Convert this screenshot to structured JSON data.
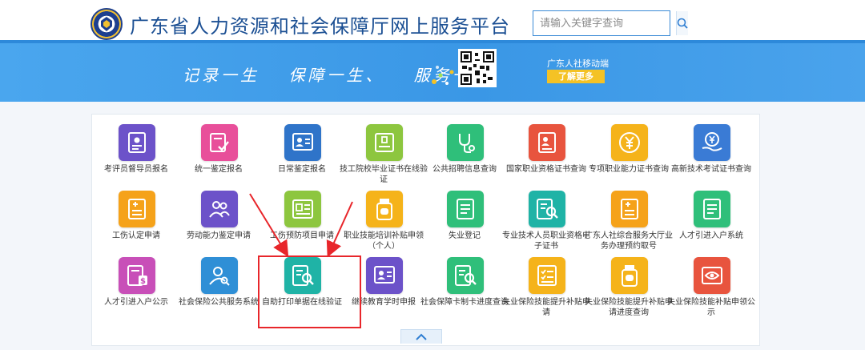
{
  "header": {
    "title": "广东省人力资源和社会保障厅网上服务平台",
    "search_placeholder": "请输入关键字查询",
    "logo_icon": "emblem-icon",
    "search_icon": "search-icon"
  },
  "banner": {
    "slogan": [
      "记录一生",
      "保障一生、",
      "服务一生"
    ],
    "mobile_label": "广东人社移动端",
    "more_button": "了解更多"
  },
  "services": [
    {
      "label": "考评员督导员报名",
      "icon": "id-card-icon",
      "color": "#6c52c9"
    },
    {
      "label": "统一鉴定报名",
      "icon": "document-check-icon",
      "color": "#e84f9a"
    },
    {
      "label": "日常鉴定报名",
      "icon": "profile-card-icon",
      "color": "#2f74c9"
    },
    {
      "label": "技工院校毕业证书在线验证",
      "icon": "certificate-icon",
      "color": "#8dc63f"
    },
    {
      "label": "公共招聘信息查询",
      "icon": "stethoscope-icon",
      "color": "#2fbf7a"
    },
    {
      "label": "国家职业资格证书查询",
      "icon": "person-document-icon",
      "color": "#e8543e"
    },
    {
      "label": "专项职业能力证书查询",
      "icon": "yen-coin-icon",
      "color": "#f5b31a"
    },
    {
      "label": "高新技术考试证书查询",
      "icon": "yen-hand-icon",
      "color": "#3a7bd5"
    },
    {
      "label": "工伤认定申请",
      "icon": "form-plus-icon",
      "color": "#f5a21a"
    },
    {
      "label": "劳动能力鉴定申请",
      "icon": "people-icon",
      "color": "#6c52c9"
    },
    {
      "label": "工伤预防项目申请",
      "icon": "list-card-icon",
      "color": "#8dc63f"
    },
    {
      "label": "职业技能培训补贴申领（个人）",
      "icon": "medicine-bottle-icon",
      "color": "#f5b31a"
    },
    {
      "label": "失业登记",
      "icon": "form-lines-icon",
      "color": "#2fbf7a"
    },
    {
      "label": "专业技术人员职业资格电子证书",
      "icon": "search-document-icon",
      "color": "#1fb3a6"
    },
    {
      "label": "广东人社综合服务大厅业务办理预约取号",
      "icon": "form-plus-icon",
      "color": "#f5a21a"
    },
    {
      "label": "人才引进入户系统",
      "icon": "form-lines-icon",
      "color": "#2fbf7a"
    },
    {
      "label": "人才引进入户公示",
      "icon": "dollar-document-icon",
      "color": "#c84fb8"
    },
    {
      "label": "社会保险公共服务系统",
      "icon": "user-search-icon",
      "color": "#2f8fd6"
    },
    {
      "label": "自助打印单据在线验证",
      "icon": "search-document-icon",
      "color": "#1fb3a6"
    },
    {
      "label": "继续教育学时申报",
      "icon": "profile-card-icon",
      "color": "#6c52c9"
    },
    {
      "label": "社会保障卡制卡进度查询",
      "icon": "search-document-icon",
      "color": "#2fbf7a"
    },
    {
      "label": "失业保险技能提升补贴申请",
      "icon": "checklist-icon",
      "color": "#f5b31a"
    },
    {
      "label": "失业保险技能提升补贴申请进度查询",
      "icon": "medicine-bottle-icon",
      "color": "#f5b31a"
    },
    {
      "label": "失业保险技能补贴申领公示",
      "icon": "eye-card-icon",
      "color": "#e8543e"
    }
  ],
  "colors": {
    "brand_blue": "#1b4f93",
    "banner_blue": "#3a97e6",
    "highlight_red": "#e8262b"
  }
}
